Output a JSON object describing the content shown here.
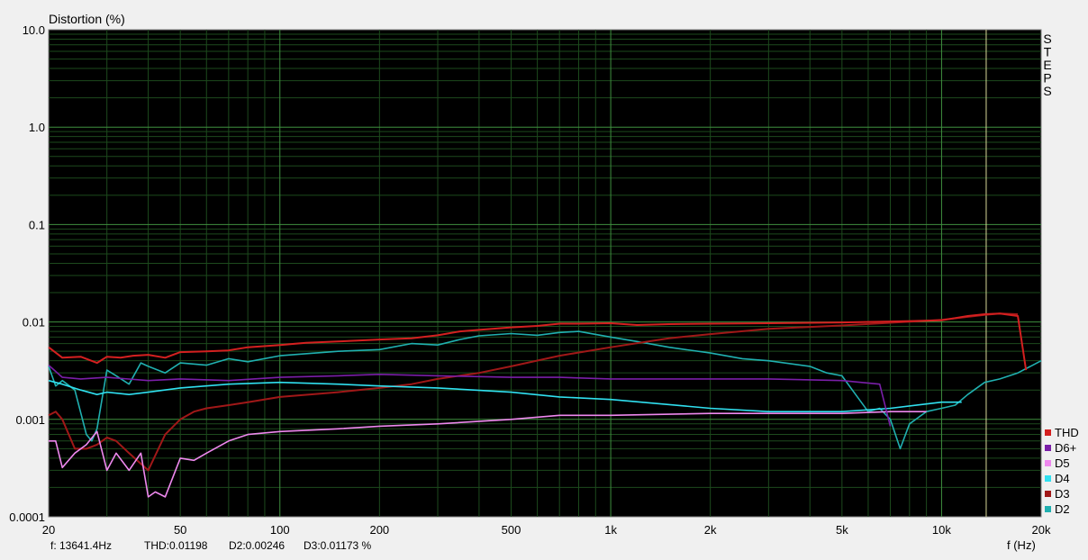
{
  "chart_data": {
    "type": "line",
    "title": "",
    "ylabel": "Distortion (%)",
    "xlabel": "f (Hz)",
    "xscale": "log",
    "yscale": "log",
    "xlim": [
      20,
      20000
    ],
    "ylim": [
      0.0001,
      10.0
    ],
    "grid": true,
    "legend_position": "right-bottom",
    "x_tick_labels": [
      {
        "value": 20,
        "label": "20"
      },
      {
        "value": 50,
        "label": "50"
      },
      {
        "value": 100,
        "label": "100"
      },
      {
        "value": 200,
        "label": "200"
      },
      {
        "value": 500,
        "label": "500"
      },
      {
        "value": 1000,
        "label": "1k"
      },
      {
        "value": 2000,
        "label": "2k"
      },
      {
        "value": 5000,
        "label": "5k"
      },
      {
        "value": 10000,
        "label": "10k"
      },
      {
        "value": 20000,
        "label": "20k"
      }
    ],
    "y_tick_labels": [
      {
        "value": 10,
        "label": "10.0"
      },
      {
        "value": 1,
        "label": "1.0"
      },
      {
        "value": 0.1,
        "label": "0.1"
      },
      {
        "value": 0.01,
        "label": "0.01"
      },
      {
        "value": 0.001,
        "label": "0.001"
      },
      {
        "value": 0.0001,
        "label": "0.0001"
      }
    ],
    "cursor_frequency": 13641.4,
    "side_label": "STEPS",
    "series": [
      {
        "name": "THD",
        "color": "#d42020",
        "x": [
          20,
          22,
          25,
          28,
          30,
          33,
          36,
          40,
          45,
          50,
          60,
          70,
          80,
          100,
          120,
          150,
          200,
          250,
          300,
          350,
          400,
          500,
          600,
          700,
          800,
          1000,
          1200,
          1500,
          2000,
          3000,
          5000,
          7000,
          10000,
          12000,
          13500,
          15000,
          17000,
          18000
        ],
        "y": [
          0.0055,
          0.0043,
          0.0044,
          0.0038,
          0.0044,
          0.0043,
          0.0045,
          0.0046,
          0.0043,
          0.0049,
          0.005,
          0.0051,
          0.0055,
          0.0058,
          0.0061,
          0.0063,
          0.0066,
          0.0068,
          0.0073,
          0.008,
          0.0083,
          0.0088,
          0.0091,
          0.0096,
          0.0096,
          0.0097,
          0.0093,
          0.0095,
          0.0096,
          0.0097,
          0.0099,
          0.0101,
          0.0104,
          0.0115,
          0.012,
          0.0122,
          0.0115,
          0.0032
        ]
      },
      {
        "name": "D6+",
        "color": "#7a1fa8",
        "x": [
          20,
          22,
          25,
          30,
          40,
          50,
          70,
          100,
          150,
          200,
          300,
          500,
          700,
          1000,
          2000,
          3000,
          5000,
          6500,
          7000
        ],
        "y": [
          0.0036,
          0.0027,
          0.0026,
          0.0027,
          0.0025,
          0.0026,
          0.0025,
          0.0027,
          0.0028,
          0.0029,
          0.0028,
          0.0027,
          0.0027,
          0.0026,
          0.0026,
          0.0026,
          0.0025,
          0.0023,
          0.00085
        ]
      },
      {
        "name": "D5",
        "color": "#ee88ee",
        "x": [
          20,
          21,
          22,
          24,
          26,
          28,
          30,
          32,
          35,
          38,
          40,
          42,
          45,
          50,
          55,
          60,
          70,
          80,
          100,
          150,
          200,
          300,
          500,
          700,
          1000,
          2000,
          3000,
          5000,
          7000,
          9000
        ],
        "y": [
          0.0006,
          0.0006,
          0.00032,
          0.00045,
          0.00055,
          0.00075,
          0.0003,
          0.00045,
          0.0003,
          0.00045,
          0.00016,
          0.00018,
          0.00016,
          0.0004,
          0.00038,
          0.00045,
          0.0006,
          0.0007,
          0.00075,
          0.0008,
          0.00085,
          0.0009,
          0.001,
          0.0011,
          0.0011,
          0.00115,
          0.00115,
          0.00115,
          0.0012,
          0.0012
        ]
      },
      {
        "name": "D4",
        "color": "#30e0f0",
        "x": [
          20,
          22,
          25,
          28,
          30,
          35,
          40,
          50,
          70,
          100,
          150,
          200,
          300,
          500,
          700,
          1000,
          2000,
          3000,
          5000,
          7000,
          10000,
          11500
        ],
        "y": [
          0.0025,
          0.0023,
          0.002,
          0.0018,
          0.0019,
          0.0018,
          0.0019,
          0.0021,
          0.0023,
          0.0024,
          0.0023,
          0.0022,
          0.0021,
          0.0019,
          0.0017,
          0.0016,
          0.0013,
          0.0012,
          0.0012,
          0.0013,
          0.0015,
          0.0015
        ]
      },
      {
        "name": "D3",
        "color": "#a01818",
        "x": [
          20,
          21,
          22,
          24,
          26,
          28,
          30,
          32,
          35,
          38,
          40,
          45,
          50,
          55,
          60,
          70,
          80,
          100,
          150,
          200,
          250,
          300,
          400,
          500,
          700,
          1000,
          1500,
          2000,
          3000,
          5000,
          7000,
          10000,
          13500,
          15000,
          17000
        ],
        "y": [
          0.0011,
          0.0012,
          0.001,
          0.0005,
          0.0005,
          0.00055,
          0.00065,
          0.0006,
          0.00045,
          0.00035,
          0.0003,
          0.0007,
          0.001,
          0.0012,
          0.0013,
          0.0014,
          0.0015,
          0.0017,
          0.0019,
          0.0021,
          0.0023,
          0.0026,
          0.003,
          0.0035,
          0.0045,
          0.0055,
          0.0068,
          0.0075,
          0.0085,
          0.0092,
          0.0098,
          0.0105,
          0.0118,
          0.0122,
          0.012
        ]
      },
      {
        "name": "D2",
        "color": "#20b0b0",
        "x": [
          20,
          21,
          22,
          24,
          26,
          27,
          28,
          30,
          32,
          35,
          38,
          40,
          45,
          50,
          60,
          70,
          80,
          100,
          150,
          200,
          250,
          300,
          350,
          400,
          500,
          600,
          700,
          800,
          1000,
          1200,
          1500,
          2000,
          2500,
          3000,
          4000,
          4500,
          5000,
          5500,
          6000,
          6500,
          7000,
          7500,
          8000,
          9000,
          10000,
          11000,
          12000,
          13500,
          15000,
          17000,
          20000
        ],
        "y": [
          0.0035,
          0.0022,
          0.0025,
          0.002,
          0.0007,
          0.0006,
          0.0008,
          0.0032,
          0.0028,
          0.0023,
          0.0038,
          0.0035,
          0.003,
          0.0038,
          0.0036,
          0.0042,
          0.0039,
          0.0045,
          0.005,
          0.0052,
          0.006,
          0.0058,
          0.0066,
          0.0072,
          0.0076,
          0.0073,
          0.0078,
          0.008,
          0.007,
          0.0063,
          0.0055,
          0.0048,
          0.0042,
          0.004,
          0.0035,
          0.003,
          0.0028,
          0.0018,
          0.0012,
          0.0013,
          0.001,
          0.0005,
          0.0009,
          0.0012,
          0.0013,
          0.0014,
          0.0018,
          0.0024,
          0.0026,
          0.003,
          0.004
        ]
      }
    ],
    "legend_order": [
      "THD",
      "D6+",
      "D5",
      "D4",
      "D3",
      "D2"
    ]
  },
  "status_bar": {
    "frequency": "f: 13641.4Hz",
    "thd": "THD:0.01198",
    "d2": "D2:0.00246",
    "d3": "D3:0.01173 %"
  }
}
